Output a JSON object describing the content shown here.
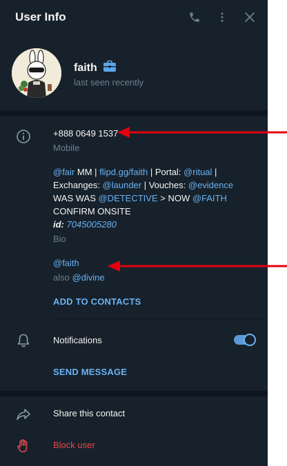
{
  "header": {
    "title": "User Info",
    "icons": [
      "phone-icon",
      "more-vertical-icon",
      "close-icon"
    ]
  },
  "profile": {
    "name": "faith",
    "badge_icon": "briefcase-icon",
    "status": "last seen recently"
  },
  "info": {
    "phone": "+888 0649 1537",
    "phone_label": "Mobile",
    "bio": {
      "line1": {
        "mention": "@fair",
        "t1": " MM | ",
        "link": "flipd.gg/faith",
        "t2": " | Portal: ",
        "mention2": "@ritual",
        "t3": " |"
      },
      "line2": {
        "t1": "Exchanges: ",
        "mention": "@launder",
        "t2": " | Vouches: ",
        "mention2": "@evidence"
      },
      "line3": {
        "t1": "WAS WAS ",
        "mention": "@DETECTIVE",
        "t2": " > NOW ",
        "mention2": "@FAITH"
      },
      "line4": "CONFIRM ONSITE",
      "line5": {
        "label": "id:",
        "value": "7045005280"
      }
    },
    "bio_label": "Bio",
    "username": "@faith",
    "also": {
      "prefix": "also ",
      "value": "@divine"
    },
    "add_to_contacts": "ADD TO CONTACTS"
  },
  "notifications": {
    "label": "Notifications",
    "enabled": true,
    "send_message": "SEND MESSAGE"
  },
  "actions": {
    "share": "Share this contact",
    "block": "Block user"
  },
  "colors": {
    "panel_bg": "#17212b",
    "separator": "#0e1621",
    "accent": "#6ab2f2",
    "danger": "#e5494b",
    "annotation_arrow": "#e3000f"
  }
}
